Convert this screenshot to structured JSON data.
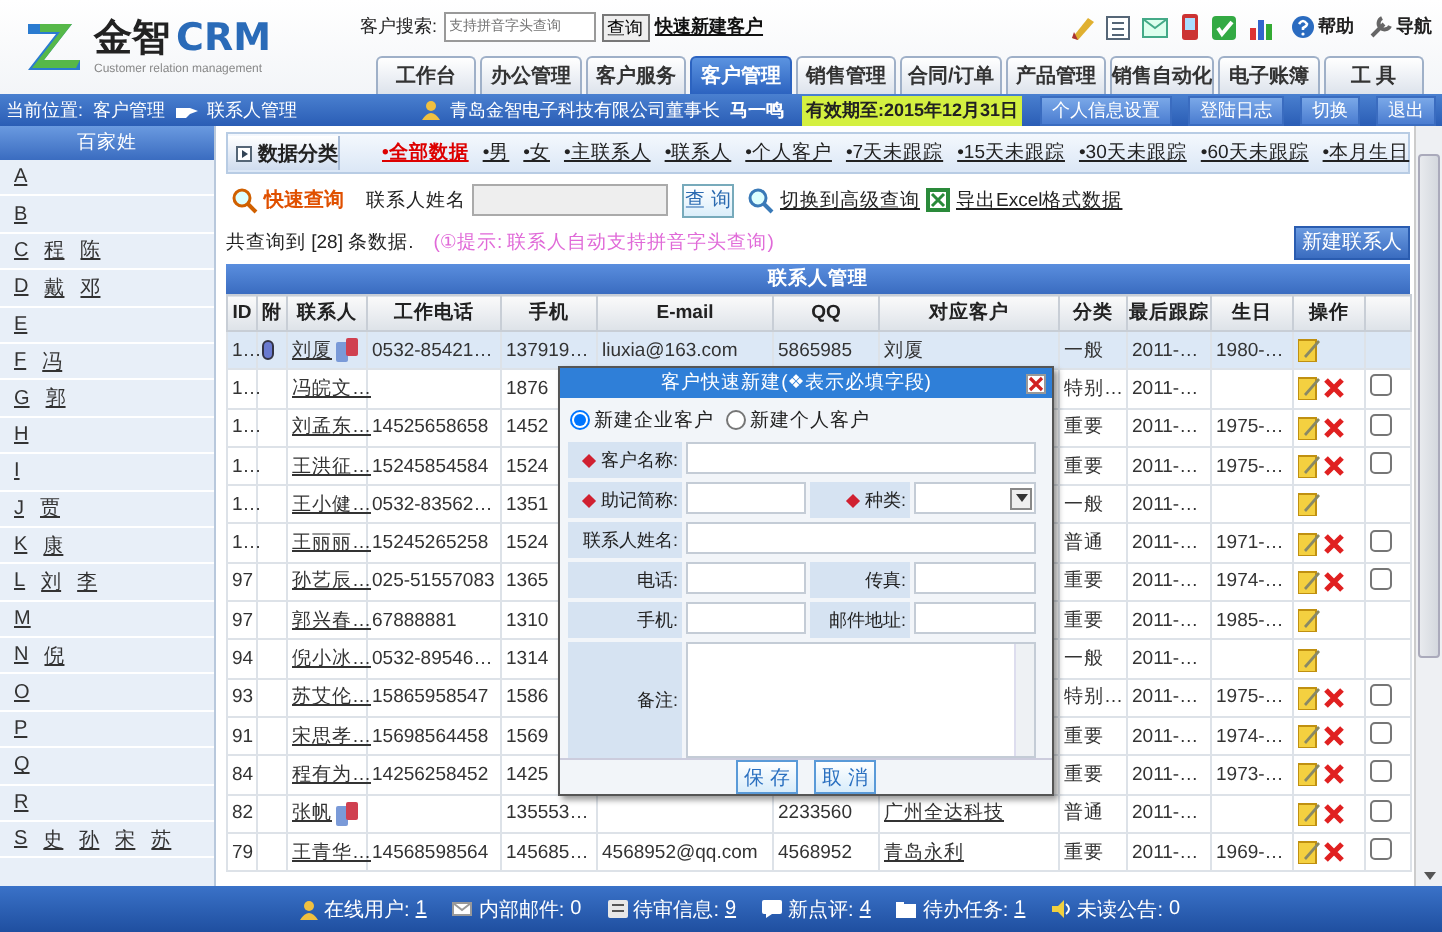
{
  "header": {
    "logo": {
      "brand": "金智",
      "product": "CRM",
      "tagline": "Customer relation management"
    },
    "search": {
      "label": "客户搜索:",
      "placeholder": "支持拼音字头查询",
      "button": "查询",
      "link": "快速新建客户"
    },
    "help": "帮助",
    "guide": "导航",
    "tabs": [
      {
        "label": "工作台",
        "selected": false
      },
      {
        "label": "办公管理",
        "selected": false
      },
      {
        "label": "客户服务",
        "selected": false
      },
      {
        "label": "客户管理",
        "selected": true
      },
      {
        "label": "销售管理",
        "selected": false
      },
      {
        "label": "合同/订单",
        "selected": false
      },
      {
        "label": "产品管理",
        "selected": false
      },
      {
        "label": "销售自动化",
        "selected": false
      },
      {
        "label": "电子账簿",
        "selected": false
      },
      {
        "label": "工 具",
        "selected": false
      }
    ]
  },
  "location": {
    "label": "当前位置:",
    "path": [
      "客户管理",
      "联系人管理"
    ],
    "company": "青岛金智电子科技有限公司董事长",
    "user": "马一鸣",
    "expiry": "有效期至:2015年12月31日",
    "buttons": [
      "个人信息设置",
      "登陆日志",
      "切换",
      "退出"
    ]
  },
  "sidebar": {
    "title": "百家姓",
    "items": [
      {
        "letter": "A"
      },
      {
        "letter": "B"
      },
      {
        "letter": "C",
        "names": [
          "程",
          "陈"
        ]
      },
      {
        "letter": "D",
        "names": [
          "戴",
          "邓"
        ]
      },
      {
        "letter": "E"
      },
      {
        "letter": "F",
        "names": [
          "冯"
        ]
      },
      {
        "letter": "G",
        "names": [
          "郭"
        ]
      },
      {
        "letter": "H"
      },
      {
        "letter": "I"
      },
      {
        "letter": "J",
        "names": [
          "贾"
        ]
      },
      {
        "letter": "K",
        "names": [
          "康"
        ]
      },
      {
        "letter": "L",
        "names": [
          "刘",
          "李"
        ]
      },
      {
        "letter": "M"
      },
      {
        "letter": "N",
        "names": [
          "倪"
        ]
      },
      {
        "letter": "O"
      },
      {
        "letter": "P"
      },
      {
        "letter": "Q"
      },
      {
        "letter": "R"
      },
      {
        "letter": "S",
        "names": [
          "史",
          "孙",
          "宋",
          "苏"
        ]
      }
    ]
  },
  "categories": {
    "title": "数据分类",
    "items": [
      {
        "label": "•全部数据",
        "selected": true
      },
      {
        "label": "•男",
        "selected": false
      },
      {
        "label": "•女",
        "selected": false
      },
      {
        "label": "•主联系人",
        "selected": false
      },
      {
        "label": "•联系人",
        "selected": false
      },
      {
        "label": "•个人客户",
        "selected": false
      },
      {
        "label": "•7天未跟踪",
        "selected": false
      },
      {
        "label": "•15天未跟踪",
        "selected": false
      },
      {
        "label": "•30天未跟踪",
        "selected": false
      },
      {
        "label": "•60天未跟踪",
        "selected": false
      },
      {
        "label": "•本月生日",
        "selected": false
      }
    ]
  },
  "quick_search": {
    "title": "快速查询",
    "field_label": "联系人姓名",
    "button": "查 询",
    "advanced": "切换到高级查询",
    "export": "导出Excel格式数据"
  },
  "result": {
    "count": "共查询到 [28] 条数据.",
    "hint": "(①提示: 联系人自动支持拼音字头查询)",
    "new_button": "新建联系人"
  },
  "table": {
    "title": "联系人管理",
    "columns": [
      "ID",
      "附",
      "联系人",
      "工作电话",
      "手机",
      "E-mail",
      "QQ",
      "对应客户",
      "分类",
      "最后跟踪",
      "生日",
      "操作"
    ],
    "rows": [
      {
        "id": "1…",
        "attachment": true,
        "contact": "刘厦",
        "phone_icon": true,
        "work_phone": "0532-85421…",
        "mobile": "137919…",
        "email": "liuxia@163.com",
        "qq": "5865985",
        "customer": "刘厦",
        "category": "一般",
        "last_follow": "2011-…",
        "birthday": "1980-…",
        "deletable": false,
        "selected": true
      },
      {
        "id": "1…",
        "contact": "冯皖文…",
        "mobile": "1876",
        "category": "特别…",
        "last_follow": "2011-…",
        "deletable": true,
        "checked": false,
        "selected": false
      },
      {
        "id": "1…",
        "contact": "刘孟东…",
        "work_phone": "14525658658",
        "mobile": "1452",
        "category": "重要",
        "last_follow": "2011-…",
        "birthday": "1975-…",
        "deletable": true,
        "checked": false,
        "selected": false
      },
      {
        "id": "1…",
        "contact": "王洪征…",
        "work_phone": "15245854584",
        "mobile": "1524",
        "category": "重要",
        "last_follow": "2011-…",
        "birthday": "1975-…",
        "deletable": true,
        "checked": false,
        "selected": false
      },
      {
        "id": "1…",
        "contact": "王小健…",
        "work_phone": "0532-83562…",
        "mobile": "1351",
        "category": "一般",
        "last_follow": "2011-…",
        "deletable": false,
        "selected": false
      },
      {
        "id": "1…",
        "contact": "王丽丽…",
        "work_phone": "15245265258",
        "mobile": "1524",
        "category": "普通",
        "last_follow": "2011-…",
        "birthday": "1971-…",
        "deletable": true,
        "checked": false,
        "selected": false
      },
      {
        "id": "97",
        "contact": "孙艺辰…",
        "work_phone": "025-51557083",
        "mobile": "1365",
        "category": "重要",
        "last_follow": "2011-…",
        "birthday": "1974-…",
        "deletable": true,
        "checked": false,
        "selected": false
      },
      {
        "id": "97",
        "contact": "郭兴春…",
        "work_phone": "67888881",
        "mobile": "1310",
        "category": "重要",
        "last_follow": "2011-…",
        "birthday": "1985-…",
        "deletable": false,
        "selected": false
      },
      {
        "id": "94",
        "contact": "倪小冰…",
        "work_phone": "0532-89546…",
        "mobile": "1314",
        "category": "一般",
        "last_follow": "2011-…",
        "deletable": false,
        "selected": false
      },
      {
        "id": "93",
        "contact": "苏艾伦…",
        "work_phone": "15865958547",
        "mobile": "1586",
        "category": "特别…",
        "last_follow": "2011-…",
        "birthday": "1975-…",
        "deletable": true,
        "checked": false,
        "selected": false
      },
      {
        "id": "91",
        "contact": "宋思孝…",
        "work_phone": "15698564458",
        "mobile": "1569",
        "category": "重要",
        "last_follow": "2011-…",
        "birthday": "1974-…",
        "deletable": true,
        "checked": false,
        "selected": false
      },
      {
        "id": "84",
        "contact": "程有为…",
        "work_phone": "14256258452",
        "mobile": "1425",
        "category": "重要",
        "last_follow": "2011-…",
        "birthday": "1973-…",
        "deletable": true,
        "checked": false,
        "selected": false
      },
      {
        "id": "82",
        "contact": "张帆",
        "phone_icon": true,
        "mobile": "135553…",
        "qq": "2233560",
        "customer": "广州全达科技",
        "customer_link": true,
        "category": "普通",
        "last_follow": "2011-…",
        "deletable": true,
        "checked": false,
        "selected": false
      },
      {
        "id": "79",
        "contact": "王青华…",
        "work_phone": "14568598564",
        "mobile": "145685…",
        "email": "4568952@qq.com",
        "qq": "4568952",
        "customer": "青岛永利",
        "customer_link": true,
        "category": "重要",
        "last_follow": "2011-…",
        "birthday": "1969-…",
        "deletable": true,
        "checked": false,
        "selected": false
      }
    ]
  },
  "dialog": {
    "title": "客户快速新建(❖表示必填字段)",
    "types": [
      {
        "label": "新建企业客户",
        "selected": true
      },
      {
        "label": "新建个人客户",
        "selected": false
      }
    ],
    "fields": [
      {
        "label": "客户名称:",
        "required": true,
        "kind": "wide"
      },
      {
        "label": "助记简称:",
        "required": true,
        "kind": "half"
      },
      {
        "label": "种类:",
        "required": true,
        "kind": "select"
      },
      {
        "label": "联系人姓名:",
        "required": false,
        "kind": "wide"
      },
      {
        "label": "电话:",
        "required": false,
        "kind": "half"
      },
      {
        "label": "传真:",
        "required": false,
        "kind": "half"
      },
      {
        "label": "手机:",
        "required": false,
        "kind": "half"
      },
      {
        "label": "邮件地址:",
        "required": false,
        "kind": "half"
      },
      {
        "label": "备注:",
        "required": false,
        "kind": "textarea"
      }
    ],
    "buttons": [
      "保 存",
      "取 消"
    ]
  },
  "status_bar": [
    {
      "kind": "user",
      "label": "在线用户:",
      "value": "1",
      "link": true
    },
    {
      "kind": "mail",
      "label": "内部邮件:",
      "value": "0",
      "link": false
    },
    {
      "kind": "review",
      "label": "待审信息:",
      "value": "9",
      "link": true
    },
    {
      "kind": "comment",
      "label": "新点评:",
      "value": "4",
      "link": true
    },
    {
      "kind": "task",
      "label": "待办任务:",
      "value": "1",
      "link": true
    },
    {
      "kind": "notice",
      "label": "未读公告:",
      "value": "0",
      "link": false
    }
  ]
}
